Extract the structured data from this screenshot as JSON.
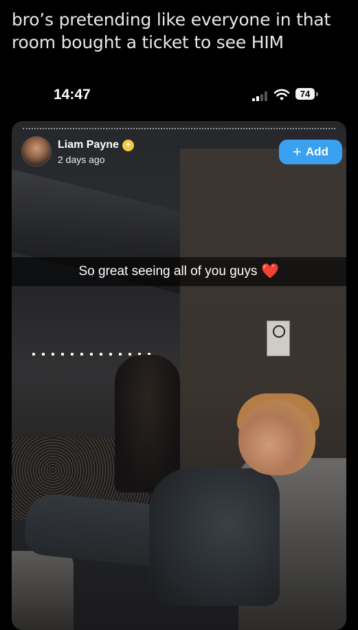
{
  "post": {
    "text": "bro’s pretending like everyone in that room bought a ticket to see HIM"
  },
  "status_bar": {
    "time": "14:47",
    "battery": "74",
    "icons": [
      "signal-icon",
      "wifi-icon",
      "battery-icon"
    ]
  },
  "story": {
    "username": "Liam Payne",
    "posted_time": "2 days ago",
    "add_label": "Add",
    "caption": "So great seeing all of you guys",
    "caption_emoji": "❤️",
    "icons": [
      "avatar",
      "verified-badge-icon",
      "plus-icon",
      "heart-icon"
    ],
    "colors": {
      "add_button": "#3aa0f0",
      "badge": "#f6c945"
    }
  }
}
